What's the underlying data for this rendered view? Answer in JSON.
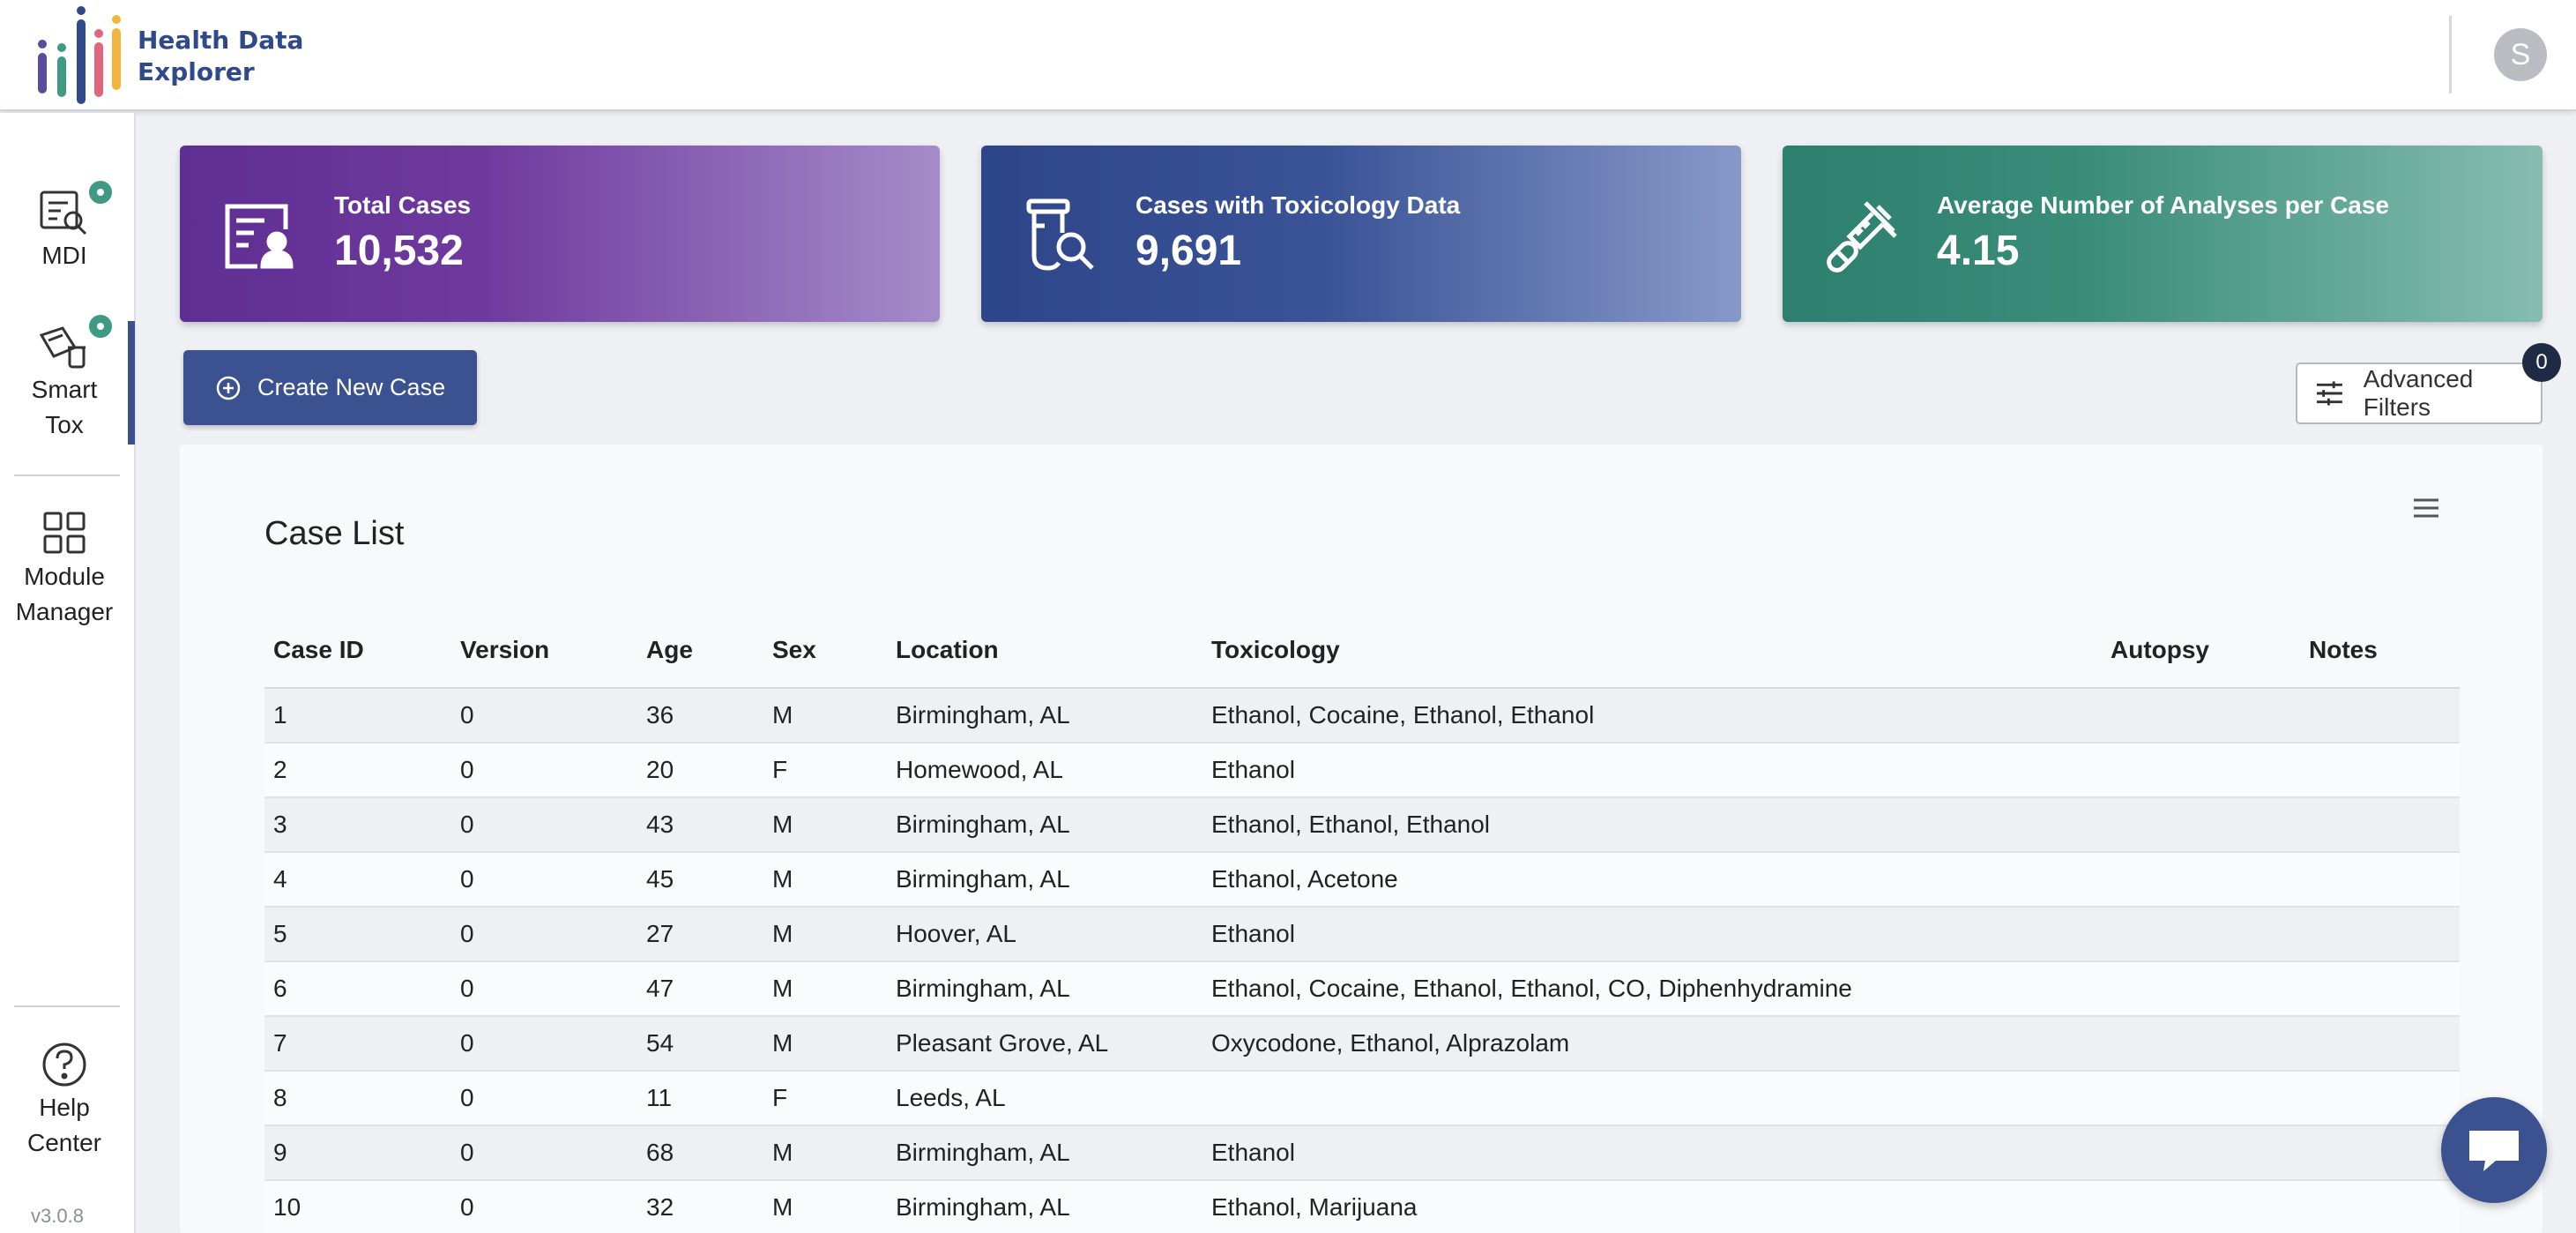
{
  "app": {
    "brand_line1": "Health Data",
    "brand_line2": "Explorer",
    "user_initial": "S",
    "version": "v3.0.8"
  },
  "colors": {
    "primary": "#3b5190",
    "card_purple": "#6f3a9e",
    "card_blue": "#3a5396",
    "card_green": "#3a8d79",
    "badge_green": "#3e9a84"
  },
  "sidebar": {
    "items": [
      {
        "label": "MDI",
        "icon": "mdi-report-search-icon"
      },
      {
        "label": "Smart Tox",
        "icon": "smart-tox-icon"
      },
      {
        "label": "Module Manager",
        "icon": "grid-icon"
      },
      {
        "label": "Help Center",
        "icon": "help-icon"
      }
    ]
  },
  "stats": [
    {
      "label": "Total Cases",
      "value": "10,532",
      "icon": "person-card-icon"
    },
    {
      "label": "Cases with Toxicology Data",
      "value": "9,691",
      "icon": "vial-search-icon"
    },
    {
      "label": "Average Number of Analyses per Case",
      "value": "4.15",
      "icon": "syringe-pill-icon"
    }
  ],
  "actions": {
    "create_label": "Create New Case",
    "filters_label": "Advanced Filters",
    "filters_count": "0"
  },
  "case_list": {
    "title": "Case List",
    "columns": [
      "Case ID",
      "Version",
      "Age",
      "Sex",
      "Location",
      "Toxicology",
      "Autopsy",
      "Notes"
    ],
    "rows": [
      [
        "1",
        "0",
        "36",
        "M",
        "Birmingham, AL",
        "Ethanol, Cocaine, Ethanol, Ethanol",
        "",
        ""
      ],
      [
        "2",
        "0",
        "20",
        "F",
        "Homewood, AL",
        "Ethanol",
        "",
        ""
      ],
      [
        "3",
        "0",
        "43",
        "M",
        "Birmingham, AL",
        "Ethanol, Ethanol, Ethanol",
        "",
        ""
      ],
      [
        "4",
        "0",
        "45",
        "M",
        "Birmingham, AL",
        "Ethanol, Acetone",
        "",
        ""
      ],
      [
        "5",
        "0",
        "27",
        "M",
        "Hoover, AL",
        "Ethanol",
        "",
        ""
      ],
      [
        "6",
        "0",
        "47",
        "M",
        "Birmingham, AL",
        "Ethanol, Cocaine, Ethanol, Ethanol, CO, Diphenhydramine",
        "",
        ""
      ],
      [
        "7",
        "0",
        "54",
        "M",
        "Pleasant Grove, AL",
        "Oxycodone, Ethanol, Alprazolam",
        "",
        ""
      ],
      [
        "8",
        "0",
        "11",
        "F",
        "Leeds, AL",
        "",
        "",
        ""
      ],
      [
        "9",
        "0",
        "68",
        "M",
        "Birmingham, AL",
        "Ethanol",
        "",
        ""
      ],
      [
        "10",
        "0",
        "32",
        "M",
        "Birmingham, AL",
        "Ethanol, Marijuana",
        "",
        ""
      ]
    ]
  }
}
